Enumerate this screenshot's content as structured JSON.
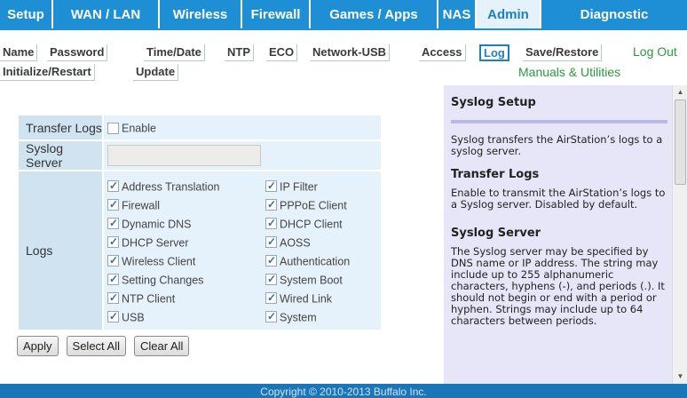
{
  "top_tabs": [
    {
      "label": "Setup",
      "active": false
    },
    {
      "label": "WAN / LAN",
      "active": false
    },
    {
      "label": "Wireless",
      "active": false
    },
    {
      "label": "Firewall",
      "active": false
    },
    {
      "label": "Games / Apps",
      "active": false
    },
    {
      "label": "NAS",
      "active": false
    },
    {
      "label": "Admin",
      "active": true
    },
    {
      "label": "Diagnostic",
      "active": false
    }
  ],
  "sub_tabs": [
    {
      "label": "Name",
      "active": false
    },
    {
      "label": "Password",
      "active": false
    },
    {
      "label": "Time/Date",
      "active": false
    },
    {
      "label": "NTP",
      "active": false
    },
    {
      "label": "ECO",
      "active": false
    },
    {
      "label": "Network-USB",
      "active": false
    },
    {
      "label": "Access",
      "active": false
    },
    {
      "label": "Log",
      "active": true
    },
    {
      "label": "Save/Restore",
      "active": false
    },
    {
      "label": "Initialize/Restart",
      "active": false
    },
    {
      "label": "Update",
      "active": false
    }
  ],
  "logout_label": "Log Out",
  "manuals_label": "Manuals & Utilities",
  "form": {
    "transfer_logs_label": "Transfer Logs",
    "enable_label": "Enable",
    "enable_checked": false,
    "syslog_server_label": "Syslog Server",
    "syslog_server_value": "",
    "logs_label": "Logs",
    "log_items": [
      {
        "label": "Address Translation",
        "checked": true
      },
      {
        "label": "IP Filter",
        "checked": true
      },
      {
        "label": "Firewall",
        "checked": true
      },
      {
        "label": "PPPoE Client",
        "checked": true
      },
      {
        "label": "Dynamic DNS",
        "checked": true
      },
      {
        "label": "DHCP Client",
        "checked": true
      },
      {
        "label": "DHCP Server",
        "checked": true
      },
      {
        "label": "AOSS",
        "checked": true
      },
      {
        "label": "Wireless Client",
        "checked": true
      },
      {
        "label": "Authentication",
        "checked": true
      },
      {
        "label": "Setting Changes",
        "checked": true
      },
      {
        "label": "System Boot",
        "checked": true
      },
      {
        "label": "NTP Client",
        "checked": true
      },
      {
        "label": "Wired Link",
        "checked": true
      },
      {
        "label": "USB",
        "checked": true
      },
      {
        "label": "System",
        "checked": true
      }
    ]
  },
  "buttons": {
    "apply": "Apply",
    "select_all": "Select All",
    "clear_all": "Clear All"
  },
  "help": {
    "title": "Syslog Setup",
    "intro": "Syslog transfers the AirStation’s logs to a syslog server.",
    "sections": [
      {
        "heading": "Transfer Logs",
        "text": "Enable to transmit the AirStation’s logs to a Syslog server. Disabled by default."
      },
      {
        "heading": "Syslog Server",
        "text": "The Syslog server may be specified by DNS name or IP address. The string may include up to 255 alphanumeric characters, hyphens (-), and periods (.). It should not begin or end with a period or hyphen. Strings may include up to 64 characters between periods."
      }
    ]
  },
  "footer": "Copyright © 2010-2013 Buffalo Inc.",
  "colors": {
    "nav_blue": "#1e8fd4",
    "active_tab_text": "#1c7fc4",
    "link_green": "#2a9a3e",
    "help_bg": "#e6e6f8",
    "label_cell": "#cfe3f1",
    "value_cell": "#e6f2fb"
  }
}
